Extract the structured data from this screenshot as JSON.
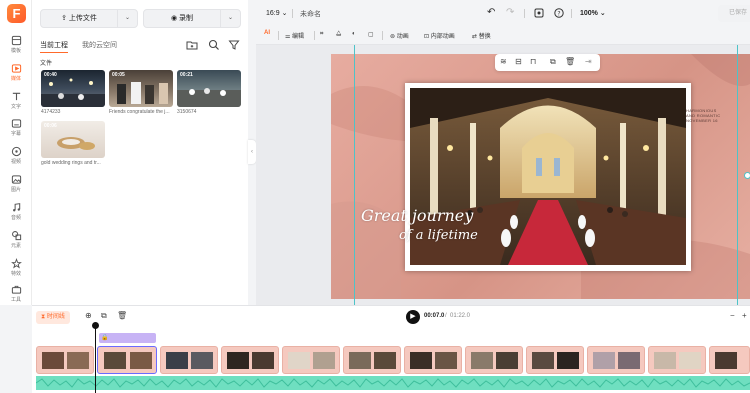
{
  "rail": {
    "logo": "F",
    "items": [
      {
        "label": "模板",
        "icon": "template-icon"
      },
      {
        "label": "媒体",
        "icon": "media-icon",
        "active": true
      },
      {
        "label": "文字",
        "icon": "text-icon"
      },
      {
        "label": "字幕",
        "icon": "subtitle-icon"
      },
      {
        "label": "视频",
        "icon": "video-icon"
      },
      {
        "label": "图片",
        "icon": "image-icon"
      },
      {
        "label": "音频",
        "icon": "music-icon"
      },
      {
        "label": "元素",
        "icon": "element-icon"
      },
      {
        "label": "特效",
        "icon": "effects-icon"
      },
      {
        "label": "工具",
        "icon": "tools-icon"
      }
    ]
  },
  "panel": {
    "upload_label": "上传文件",
    "record_label": "录制",
    "tabs": [
      {
        "label": "当前工程",
        "active": true
      },
      {
        "label": "我的云空间",
        "active": false
      }
    ],
    "folder_label": "文件",
    "media": [
      {
        "duration": "00:40",
        "caption": "4174233"
      },
      {
        "duration": "00:05",
        "caption": "Friends congratulate the j..."
      },
      {
        "duration": "00:21",
        "caption": "3150674"
      },
      {
        "duration": "00:06",
        "caption": "gold wedding rings and tr..."
      }
    ]
  },
  "topbar": {
    "ratio": "16:9",
    "project_name": "未命名",
    "zoom": "100%",
    "export_label": "已保存"
  },
  "toolbar": {
    "ai_label": "AI",
    "edit_label": "编辑",
    "animation_label": "动画",
    "inner_animation_label": "内部动画",
    "replace_label": "替换"
  },
  "canvas": {
    "script_line1": "Great journey",
    "script_line2": "of a lifetime",
    "side_text": [
      "HARMONIOUS",
      "AND ROMANTIC",
      "NOVEMBER 16"
    ]
  },
  "timeline": {
    "tab_label": "时间线",
    "current_time": "00:07.0",
    "total_time": "01:22.0"
  },
  "colors": {
    "accent": "#ff6a2b",
    "audio": "#6fdfc0",
    "clip_bg": "#f5c9bf",
    "guide": "#4ec3c8"
  }
}
